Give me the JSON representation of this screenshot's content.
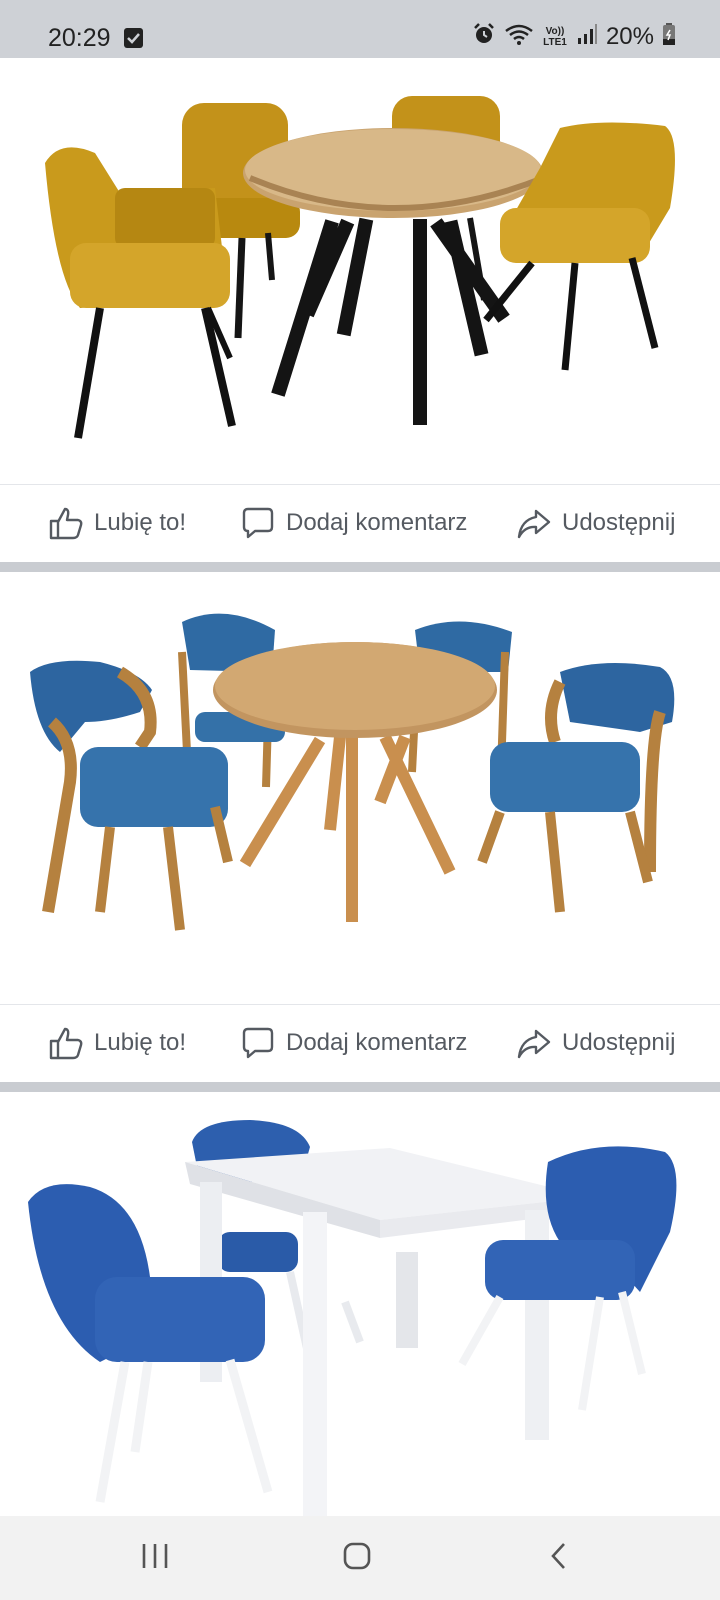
{
  "status_bar": {
    "time": "20:29",
    "network_label": "Vo)) LTE1",
    "battery": "20%"
  },
  "posts": [
    {
      "actions": {
        "like": "Lubię to!",
        "comment": "Dodaj komentarz",
        "share": "Udostępnij"
      }
    },
    {
      "actions": {
        "like": "Lubię to!",
        "comment": "Dodaj komentarz",
        "share": "Udostępnij"
      }
    },
    {
      "actions": null
    }
  ],
  "colors": {
    "status_bar_bg": "#ced1d6",
    "separator": "#c9ccd1",
    "action_text": "#555a61",
    "mustard_chair": "#c99a1c",
    "blue_chair": "#2f63a8",
    "oak_table": "#c9a06b",
    "white_table": "#f4f5f7"
  },
  "icons": [
    "check-notification-icon",
    "alarm-icon",
    "wifi-icon",
    "signal-icon",
    "battery-icon",
    "like-icon",
    "comment-icon",
    "share-icon",
    "recents-icon",
    "home-icon",
    "back-icon"
  ]
}
